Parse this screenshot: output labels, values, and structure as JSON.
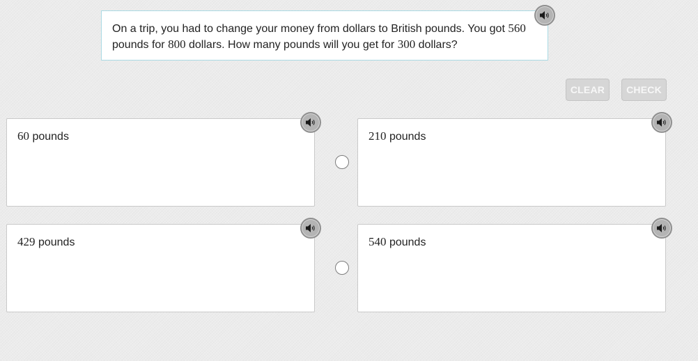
{
  "question": {
    "seg1": "On a trip, you had to change your money from dollars to British pounds. You got ",
    "num1": "560",
    "seg2": " pounds for ",
    "num2": "800",
    "seg3": " dollars. How many pounds will you get for ",
    "num3": "300",
    "seg4": " dollars?",
    "audio_icon": "speaker-icon"
  },
  "buttons": {
    "clear_label": "CLEAR",
    "check_label": "CHECK"
  },
  "answers": [
    {
      "value": "60",
      "unit": " pounds"
    },
    {
      "value": "210",
      "unit": " pounds"
    },
    {
      "value": "429",
      "unit": " pounds"
    },
    {
      "value": "540",
      "unit": " pounds"
    }
  ],
  "colors": {
    "question_border": "#a9d9e3",
    "button_disabled_bg": "#d6d6d6",
    "audio_button_bg": "#b4b4b4"
  }
}
